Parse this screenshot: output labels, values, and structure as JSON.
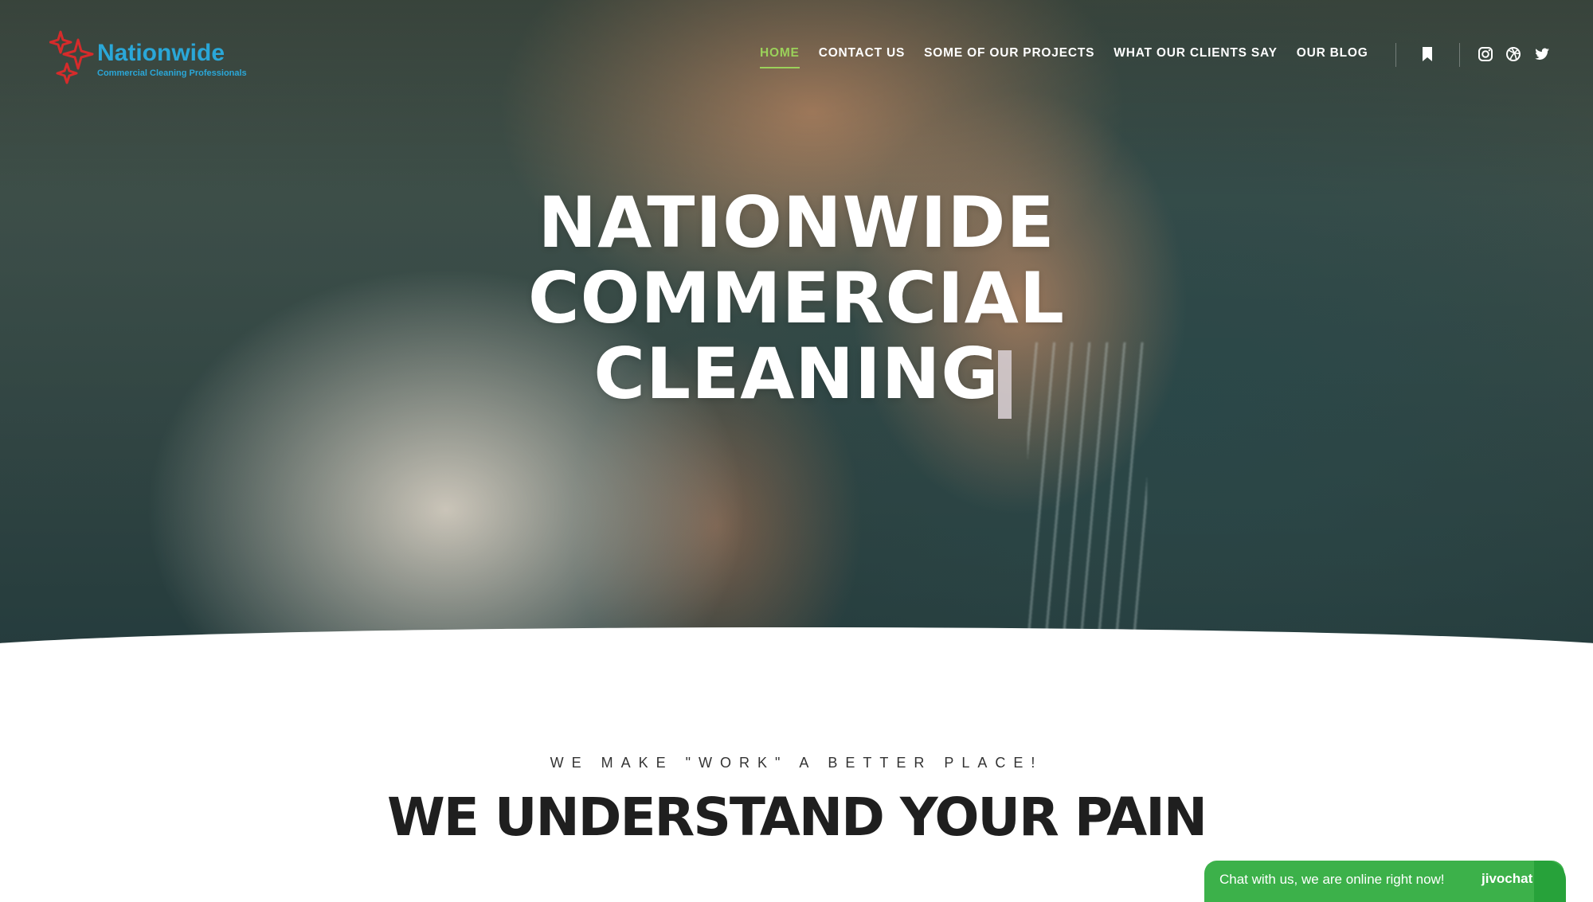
{
  "logo": {
    "title": "Nationwide",
    "subtitle": "Commercial Cleaning Professionals"
  },
  "nav": {
    "items": [
      {
        "label": "HOME",
        "active": true
      },
      {
        "label": "CONTACT US"
      },
      {
        "label": "SOME OF OUR PROJECTS"
      },
      {
        "label": "WHAT OUR CLIENTS SAY"
      },
      {
        "label": "OUR BLOG"
      }
    ],
    "icons": [
      "bookmark-icon",
      "instagram-icon",
      "dribbble-icon",
      "twitter-icon"
    ]
  },
  "hero": {
    "title_lines": [
      "NATIONWIDE",
      "COMMERCIAL",
      "CLEANING"
    ]
  },
  "section": {
    "tagline": "WE MAKE \"WORK\" A BETTER PLACE!",
    "title": "WE UNDERSTAND YOUR PAIN"
  },
  "chat": {
    "text": "Chat with us, we are online right now!",
    "brand": "jivochat"
  },
  "colors": {
    "accent": "#9bd15a",
    "logo_blue": "#2aa7d8",
    "logo_red": "#d62b2b",
    "chat_green": "#3cb14a"
  }
}
